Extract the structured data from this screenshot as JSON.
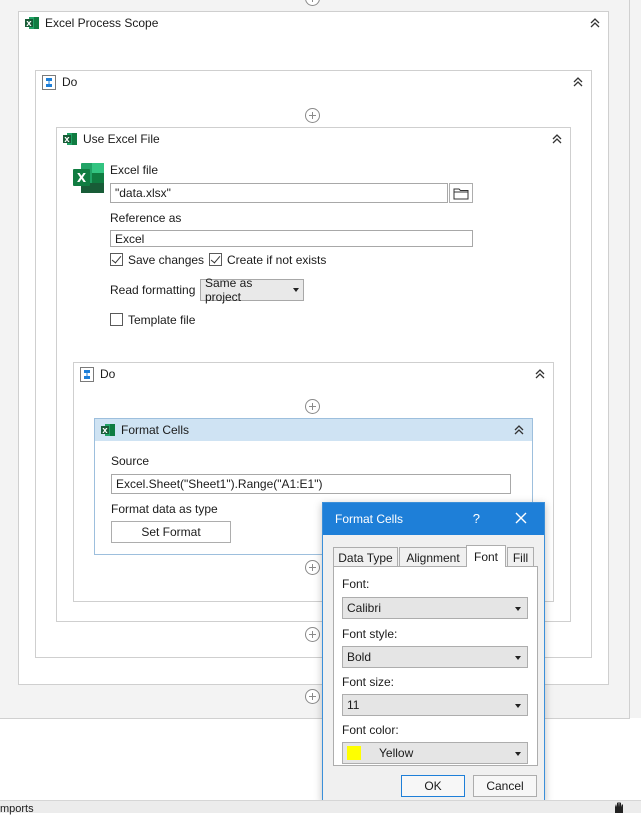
{
  "excel_process_scope": {
    "title": "Excel Process Scope"
  },
  "do_outer": {
    "title": "Do"
  },
  "use_excel_file": {
    "title": "Use Excel File",
    "excel_file_label": "Excel file",
    "excel_file_value": "\"data.xlsx\"",
    "reference_as_label": "Reference as",
    "reference_as_value": "Excel",
    "save_changes_label": "Save changes",
    "save_changes_checked": true,
    "create_if_not_exists_label": "Create if not exists",
    "create_if_not_exists_checked": true,
    "read_formatting_label": "Read formatting",
    "read_formatting_value": "Same as project",
    "template_file_label": "Template file",
    "template_file_checked": false
  },
  "do_inner": {
    "title": "Do"
  },
  "format_cells_activity": {
    "title": "Format Cells",
    "source_label": "Source",
    "source_value": "Excel.Sheet(\"Sheet1\").Range(\"A1:E1\")",
    "format_as_type_label": "Format data as type",
    "set_format_label": "Set Format"
  },
  "dialog": {
    "title": "Format Cells",
    "help": "?",
    "tabs": [
      {
        "label": "Data Type"
      },
      {
        "label": "Alignment"
      },
      {
        "label": "Font"
      },
      {
        "label": "Fill"
      }
    ],
    "active_tab": "Font",
    "font_label": "Font:",
    "font_value": "Calibri",
    "font_style_label": "Font style:",
    "font_style_value": "Bold",
    "font_size_label": "Font size:",
    "font_size_value": "11",
    "font_color_label": "Font color:",
    "font_color_value": "Yellow",
    "font_color_swatch": "#ffff00",
    "ok_label": "OK",
    "cancel_label": "Cancel"
  },
  "bottom_bar": {
    "imports_label": "mports"
  },
  "colors": {
    "accent": "#1e7fd8",
    "selected_header": "#cfe3f3",
    "excel_green": "#1d6f42"
  }
}
